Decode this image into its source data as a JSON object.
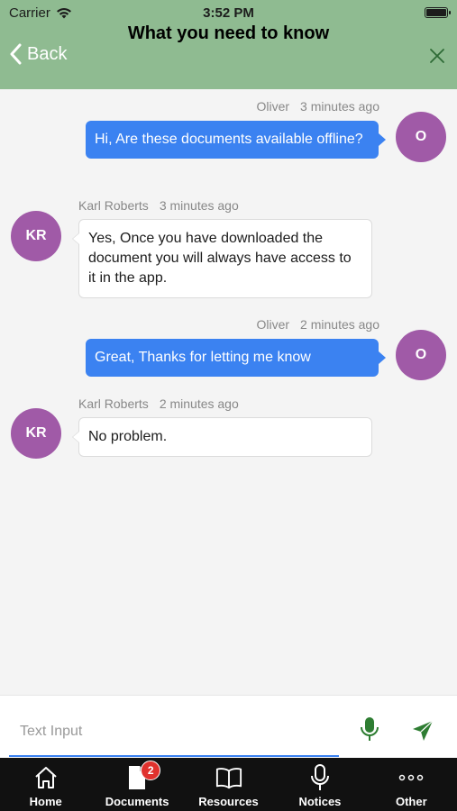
{
  "status_bar": {
    "carrier": "Carrier",
    "time": "3:52 PM"
  },
  "nav": {
    "back_label": "Back",
    "title": "What you need to know"
  },
  "messages": [
    {
      "sender": "Oliver",
      "time": "3 minutes ago",
      "initials": "O",
      "text": "Hi, Are these documents available offline?",
      "direction": "outgoing"
    },
    {
      "sender": "Karl Roberts",
      "time": "3 minutes ago",
      "initials": "KR",
      "text": "Yes, Once you have downloaded the document you will always have access to it in the app.",
      "direction": "incoming"
    },
    {
      "sender": "Oliver",
      "time": "2 minutes ago",
      "initials": "O",
      "text": "Great, Thanks for letting me know",
      "direction": "outgoing"
    },
    {
      "sender": "Karl Roberts",
      "time": "2 minutes ago",
      "initials": "KR",
      "text": "No problem.",
      "direction": "incoming"
    }
  ],
  "composer": {
    "placeholder": "Text Input"
  },
  "tabs": [
    {
      "label": "Home",
      "icon": "home-icon"
    },
    {
      "label": "Documents",
      "icon": "document-icon",
      "badge": "2"
    },
    {
      "label": "Resources",
      "icon": "book-icon"
    },
    {
      "label": "Notices",
      "icon": "microphone-icon"
    },
    {
      "label": "Other",
      "icon": "more-icon"
    }
  ],
  "colors": {
    "header": "#8fbb91",
    "outgoing_bubble": "#3b82f1",
    "avatar": "#a05aa7",
    "badge": "#e0322e",
    "accent_green": "#2e7d32"
  }
}
